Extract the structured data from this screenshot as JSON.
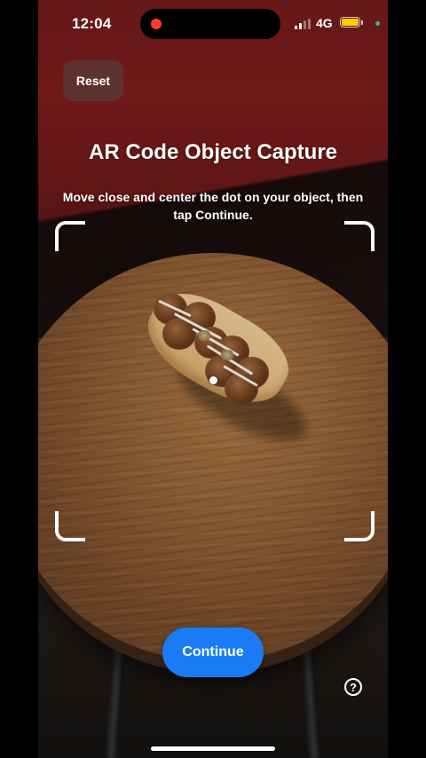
{
  "status_bar": {
    "time": "12:04",
    "network": "4G",
    "battery_level": 0.9,
    "battery_color": "#ffcc00",
    "recording_indicator_color": "#ff3b30",
    "privacy_indicator_color": "#34c759"
  },
  "header": {
    "reset_label": "Reset",
    "title": "AR Code Object Capture",
    "instructions": "Move close and center the dot on your object, then tap Continue."
  },
  "footer": {
    "continue_label": "Continue",
    "help_label": "?"
  },
  "colors": {
    "accent": "#1a7cf5"
  },
  "icons": {
    "help": "question-circle-icon",
    "signal": "cellular-signal-icon",
    "battery": "battery-icon"
  }
}
